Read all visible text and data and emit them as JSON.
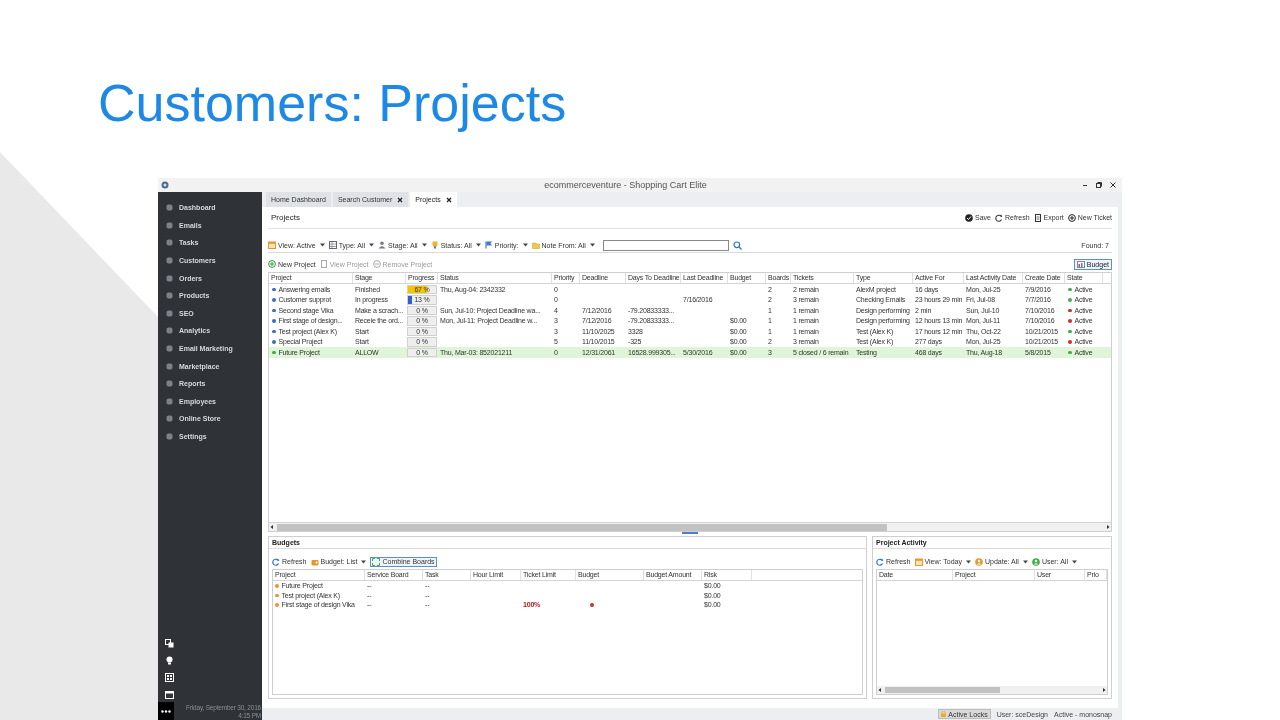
{
  "slide": {
    "title": "Customers: Projects"
  },
  "window": {
    "title": "ecommerceventure - Shopping Cart Elite"
  },
  "sidebar": {
    "items": [
      {
        "label": "Dashboard"
      },
      {
        "label": "Emails"
      },
      {
        "label": "Tasks"
      },
      {
        "label": "Customers"
      },
      {
        "label": "Orders"
      },
      {
        "label": "Products"
      },
      {
        "label": "SEO"
      },
      {
        "label": "Analytics"
      },
      {
        "label": "Email Marketing"
      },
      {
        "label": "Marketplace"
      },
      {
        "label": "Reports"
      },
      {
        "label": "Employees"
      },
      {
        "label": "Online Store"
      },
      {
        "label": "Settings"
      }
    ],
    "date": "Friday, September 30, 2016",
    "time": "4:15 PM"
  },
  "tabs": [
    {
      "label": "Home Dashboard",
      "closable": false,
      "selected": false
    },
    {
      "label": "Search Customer",
      "closable": true,
      "selected": false
    },
    {
      "label": "Projects",
      "closable": true,
      "selected": true
    }
  ],
  "page_title": "Projects",
  "header_actions": [
    "Save",
    "Refresh",
    "Export",
    "New Ticket"
  ],
  "filters": [
    "View: Active",
    "Type: All",
    "Stage: All",
    "Status: All",
    "Priority:",
    "Note From: All"
  ],
  "found": "Found: 7",
  "actions": [
    {
      "label": "New Project",
      "disabled": false
    },
    {
      "label": "View Project",
      "disabled": true
    },
    {
      "label": "Remove Project",
      "disabled": true
    }
  ],
  "budget_button": "Budget",
  "table": {
    "columns": [
      "Project",
      "Stage",
      "Progress",
      "Status",
      "Priority",
      "Deadline",
      "Days To Deadline",
      "Last Deadline",
      "Budget",
      "Boards",
      "Tickets",
      "Type",
      "Active For",
      "Last Activity Date",
      "Create Date",
      "State"
    ],
    "rows": [
      {
        "selected": false,
        "color": "#3b6db3",
        "state": {
          "color": "#3cb043"
        },
        "progress": {
          "level": 0.67,
          "color": "#f5c400"
        },
        "cells": [
          "Answering emails",
          "Finished",
          "67 %",
          "Thu, Aug-04: 2342332",
          "0",
          null,
          null,
          null,
          null,
          "2",
          "2 remain",
          "AlexM project",
          "16 days",
          "Mon, Jul-25",
          "7/9/2016",
          "Active"
        ]
      },
      {
        "selected": false,
        "color": "#3b6db3",
        "state": {
          "color": "#3cb043"
        },
        "progress": {
          "level": 0.13,
          "color": "#2f5fd0"
        },
        "cells": [
          "Customer supprot",
          "In progress",
          "13 %",
          null,
          "0",
          null,
          null,
          "7/16/2016",
          null,
          "2",
          "3 remain",
          "Checking Emails",
          "23 hours 29 min",
          "Fri, Jul-08",
          "7/7/2016",
          "Active"
        ]
      },
      {
        "selected": false,
        "color": "#3b6db3",
        "state": {
          "color": "#d42a2a"
        },
        "progress": {
          "level": 0
        },
        "cells": [
          "Second stage Vika",
          "Make a scrach...",
          "0 %",
          "Sun, Jul-10: Project Deadline wa...",
          "4",
          "7/12/2016",
          "-79.20833333...",
          null,
          null,
          "1",
          "1 remain",
          "Design performing",
          "2 min",
          "Sun, Jul-10",
          "7/10/2016",
          "Active"
        ]
      },
      {
        "selected": false,
        "color": "#3b6db3",
        "state": {
          "color": "#d42a2a"
        },
        "progress": {
          "level": 0
        },
        "cells": [
          "First stage of design...",
          "Receie the ord...",
          "0 %",
          "Mon, Jul-11: Project Deadline w...",
          "3",
          "7/12/2016",
          "-79.20833333...",
          null,
          "$0.00",
          "1",
          "1 remain",
          "Design performing",
          "12 hours 13 min",
          "Mon, Jul-11",
          "7/10/2016",
          "Active"
        ]
      },
      {
        "selected": false,
        "color": "#3b6db3",
        "state": {
          "color": "#3cb043"
        },
        "progress": {
          "level": 0
        },
        "cells": [
          "Test project (Alex K)",
          "Start",
          "0 %",
          null,
          "3",
          "11/10/2025",
          "3328",
          null,
          "$0.00",
          "1",
          "1 remain",
          "Test (Alex K)",
          "17 hours 12 min",
          "Thu, Oct-22",
          "10/21/2015",
          "Active"
        ]
      },
      {
        "selected": false,
        "color": "#3b6db3",
        "state": {
          "color": "#d42a2a"
        },
        "progress": {
          "level": 0
        },
        "cells": [
          "Special Project",
          "Start",
          "0 %",
          null,
          "5",
          "11/10/2015",
          "-325",
          null,
          "$0.00",
          "2",
          "3 remain",
          "Test (Alex K)",
          "277 days",
          "Mon, Jul-25",
          "10/21/2015",
          "Active"
        ]
      },
      {
        "selected": true,
        "color": "#3cb043",
        "state": {
          "color": "#3cb043"
        },
        "progress": {
          "level": 0
        },
        "cells": [
          "Future Project",
          "ALLOW",
          "0 %",
          "Thu, Mar-03: 852021211",
          "0",
          "12/31/2061",
          "16528.999305...",
          "5/30/2016",
          "$0.00",
          "3",
          "5 closed / 6 remain",
          "Testing",
          "468 days",
          "Thu, Aug-18",
          "5/8/2015",
          "Active"
        ]
      }
    ]
  },
  "budgets": {
    "title": "Budgets",
    "toolbar": [
      "Refresh",
      "Budget: List",
      "Combine Boards"
    ],
    "columns": [
      "Project",
      "Service Board",
      "Task",
      "Hour Limit",
      "Ticket Limit",
      "Budget",
      "Budget Amount",
      "Risk"
    ],
    "rows": [
      {
        "flag": false,
        "cells": [
          "Future Project",
          "--",
          "--",
          null,
          null,
          null,
          null,
          "$0.00"
        ]
      },
      {
        "flag": false,
        "cells": [
          "Test project (Alex K)",
          "--",
          "--",
          null,
          null,
          null,
          null,
          "$0.00"
        ]
      },
      {
        "flag": true,
        "cells": [
          "First stage of design Vika",
          "--",
          "--",
          null,
          "100%",
          null,
          null,
          "$0.00"
        ]
      }
    ]
  },
  "activity": {
    "title": "Project Activity",
    "toolbar": [
      "Refresh",
      "View: Today",
      "Update: All",
      "User: All"
    ],
    "columns": [
      "Date",
      "Project",
      "User",
      "Prio"
    ]
  },
  "status_bar": [
    "Active Locks",
    "User: sceDesign",
    "Active - monosnap"
  ]
}
